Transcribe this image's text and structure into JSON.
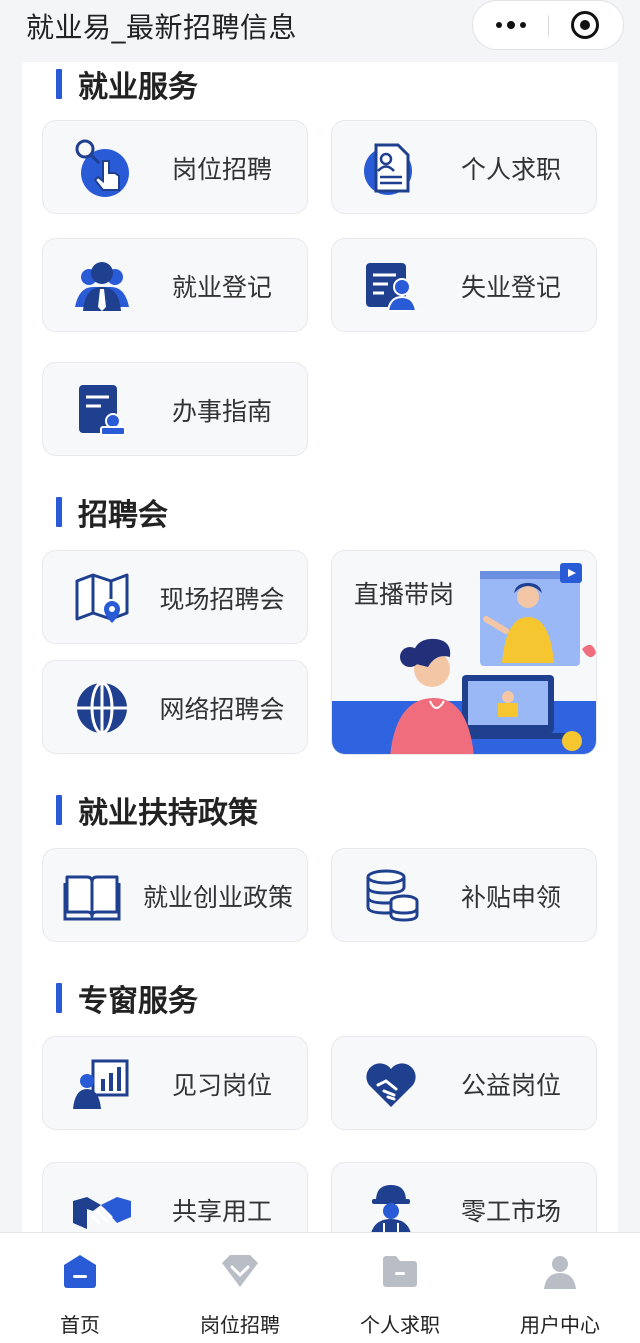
{
  "app": {
    "title": "就业易_最新招聘信息"
  },
  "sections": {
    "employment": {
      "title": "就业服务",
      "items": [
        "岗位招聘",
        "个人求职",
        "就业登记",
        "失业登记",
        "办事指南"
      ]
    },
    "fairs": {
      "title": "招聘会",
      "items": [
        "现场招聘会",
        "网络招聘会"
      ],
      "live": "直播带岗"
    },
    "policy": {
      "title": "就业扶持政策",
      "items": [
        "就业创业政策",
        "补贴申领"
      ]
    },
    "special": {
      "title": "专窗服务",
      "items": [
        "见习岗位",
        "公益岗位",
        "共享用工",
        "零工市场"
      ]
    }
  },
  "tabbar": {
    "items": [
      "首页",
      "岗位招聘",
      "个人求职",
      "用户中心"
    ],
    "active_index": 0
  },
  "colors": {
    "accent": "#2a5bd7",
    "icon_dark": "#1f3f8f",
    "inactive_icon": "#b9bdc6"
  }
}
